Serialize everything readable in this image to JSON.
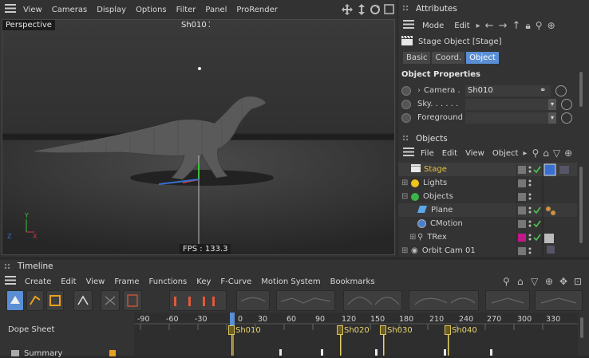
{
  "viewport": {
    "menu": [
      "View",
      "Cameras",
      "Display",
      "Options",
      "Filter",
      "Panel",
      "ProRender"
    ],
    "camera_label": "Perspective",
    "shot_label": "Sh010",
    "fps": "FPS : 133.3"
  },
  "attributes": {
    "title": "Attributes",
    "toolbar": [
      "Mode",
      "Edit"
    ],
    "object_title": "Stage Object [Stage]",
    "tabs": [
      "Basic",
      "Coord.",
      "Object"
    ],
    "active_tab": "Object",
    "section": "Object Properties",
    "props": [
      {
        "label": "Camera .",
        "value": "Sh010"
      },
      {
        "label": "Sky. . . . . .",
        "value": ""
      },
      {
        "label": "Foreground",
        "value": ""
      }
    ]
  },
  "objects": {
    "title": "Objects",
    "toolbar": [
      "File",
      "Edit",
      "View",
      "Object"
    ],
    "items": [
      {
        "name": "Stage",
        "color": "#e8c23a"
      },
      {
        "name": "Lights",
        "color": "#d0d0d0"
      },
      {
        "name": "Objects",
        "color": "#d0d0d0"
      },
      {
        "name": "Plane",
        "color": "#d0d0d0"
      },
      {
        "name": "CMotion",
        "color": "#d0d0d0"
      },
      {
        "name": "TRex",
        "color": "#d0d0d0"
      },
      {
        "name": "Orbit Cam 01",
        "color": "#d0d0d0"
      }
    ]
  },
  "timeline": {
    "title": "Timeline",
    "menu": [
      "Create",
      "Edit",
      "View",
      "Frame",
      "Functions",
      "Key",
      "F-Curve",
      "Motion System",
      "Bookmarks"
    ],
    "dope_sheet": "Dope Sheet",
    "summary": "Summary",
    "ruler": [
      "-90",
      "-60",
      "-30",
      "0",
      "30",
      "60",
      "90",
      "120",
      "150",
      "180",
      "210",
      "240",
      "270",
      "300",
      "330"
    ],
    "markers": [
      "Sh010",
      "Sh020",
      "Sh030",
      "Sh040"
    ]
  },
  "colors": {
    "accent": "#5a8fd6",
    "marker": "#e8d46a",
    "check": "#4fc24f"
  }
}
